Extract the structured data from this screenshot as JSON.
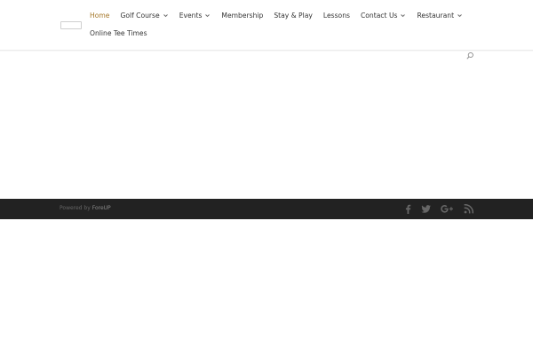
{
  "nav": {
    "items": [
      {
        "label": "Home",
        "active": true,
        "has_dropdown": false
      },
      {
        "label": "Golf Course",
        "active": false,
        "has_dropdown": true
      },
      {
        "label": "Events",
        "active": false,
        "has_dropdown": true
      },
      {
        "label": "Membership",
        "active": false,
        "has_dropdown": false
      },
      {
        "label": "Stay & Play",
        "active": false,
        "has_dropdown": false
      },
      {
        "label": "Lessons",
        "active": false,
        "has_dropdown": false
      },
      {
        "label": "Contact Us",
        "active": false,
        "has_dropdown": true
      },
      {
        "label": "Restaurant",
        "active": false,
        "has_dropdown": true
      }
    ],
    "second_row": [
      {
        "label": "Online Tee Times",
        "active": false,
        "has_dropdown": false
      }
    ]
  },
  "search": {
    "icon": "search-icon"
  },
  "footer": {
    "credit_prefix": "Powered by",
    "credit_brand": "ForeUP",
    "social": [
      "facebook-icon",
      "twitter-icon",
      "google-plus-icon",
      "rss-icon"
    ]
  },
  "colors": {
    "active_nav": "#a5782a",
    "nav_text": "#333333",
    "footer_bg": "#222222",
    "footer_icon": "#666666"
  }
}
